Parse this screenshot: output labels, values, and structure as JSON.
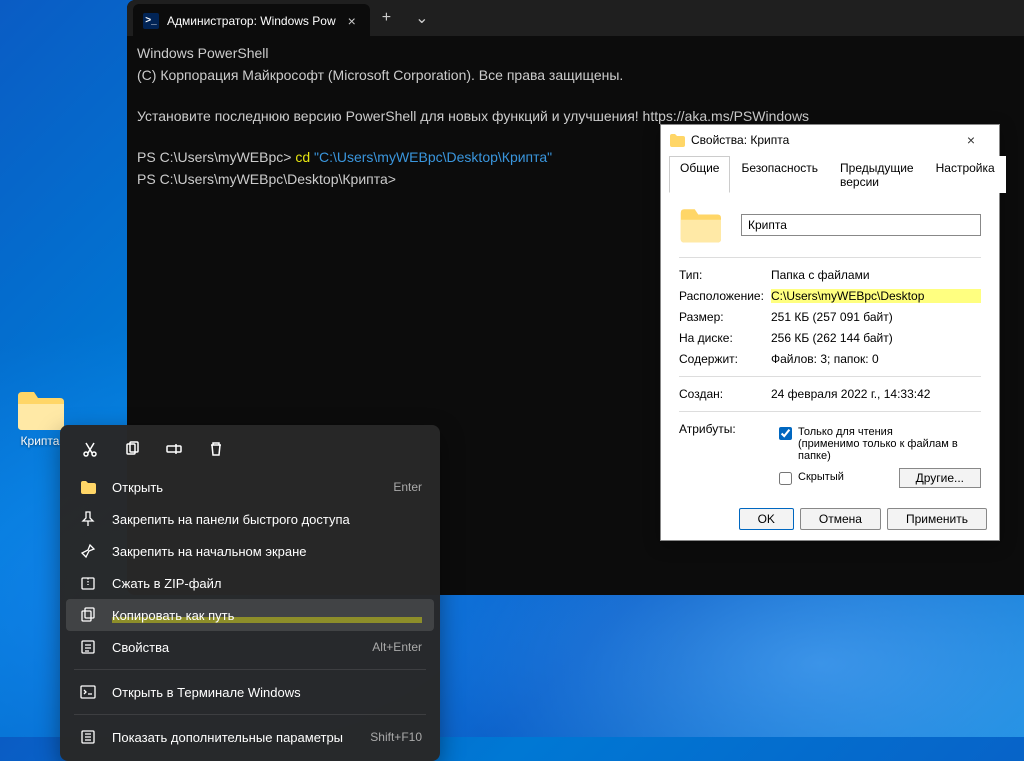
{
  "desktop": {
    "folder_label": "Крипта"
  },
  "terminal": {
    "tab_title": "Администратор: Windows Pow",
    "line1": "Windows PowerShell",
    "line2": "(C) Корпорация Майкрософт (Microsoft Corporation). Все права защищены.",
    "line3": "Установите последнюю версию PowerShell для новых функций и улучшения! https://aka.ms/PSWindows",
    "prompt1_prefix": "PS C:\\Users\\myWEBpc> ",
    "prompt1_cmd": "cd",
    "prompt1_arg": " \"C:\\Users\\myWEBpc\\Desktop\\Крипта\"",
    "prompt2": "PS C:\\Users\\myWEBpc\\Desktop\\Крипта>"
  },
  "context_menu": {
    "items": [
      {
        "label": "Открыть",
        "shortcut": "Enter",
        "icon": "folder"
      },
      {
        "label": "Закрепить на панели быстрого доступа",
        "shortcut": "",
        "icon": "pin"
      },
      {
        "label": "Закрепить на начальном экране",
        "shortcut": "",
        "icon": "pin2"
      },
      {
        "label": "Сжать в ZIP-файл",
        "shortcut": "",
        "icon": "zip"
      },
      {
        "label": "Копировать как путь",
        "shortcut": "",
        "icon": "copypath",
        "highlighted": true
      },
      {
        "label": "Свойства",
        "shortcut": "Alt+Enter",
        "icon": "props"
      },
      {
        "sep": true
      },
      {
        "label": "Открыть в Терминале Windows",
        "shortcut": "",
        "icon": "terminal"
      },
      {
        "sep": true
      },
      {
        "label": "Показать дополнительные параметры",
        "shortcut": "Shift+F10",
        "icon": "more"
      }
    ]
  },
  "properties": {
    "title": "Свойства: Крипта",
    "tabs": [
      "Общие",
      "Безопасность",
      "Предыдущие версии",
      "Настройка"
    ],
    "name_value": "Крипта",
    "rows": {
      "type_k": "Тип:",
      "type_v": "Папка с файлами",
      "loc_k": "Расположение:",
      "loc_v": "C:\\Users\\myWEBpc\\Desktop",
      "size_k": "Размер:",
      "size_v": "251 КБ (257 091 байт)",
      "disk_k": "На диске:",
      "disk_v": "256 КБ (262 144 байт)",
      "cont_k": "Содержит:",
      "cont_v": "Файлов: 3; папок: 0",
      "created_k": "Создан:",
      "created_v": "24 февраля 2022 г., 14:33:42",
      "attr_k": "Атрибуты:",
      "readonly": "Только для чтения",
      "readonly_sub": "(применимо только к файлам в папке)",
      "hidden": "Скрытый",
      "other_btn": "Другие..."
    },
    "footer": {
      "ok": "OK",
      "cancel": "Отмена",
      "apply": "Применить"
    }
  }
}
